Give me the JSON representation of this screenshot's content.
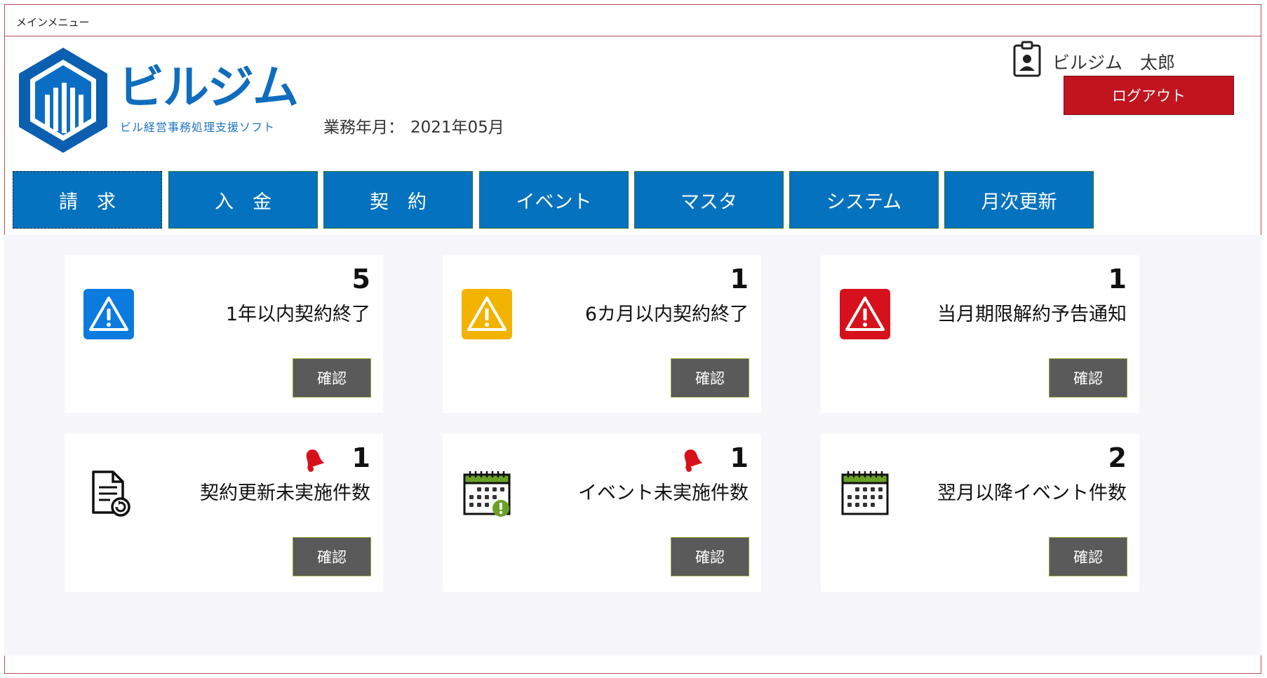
{
  "window": {
    "title": "メインメニュー"
  },
  "brand": {
    "name": "ビルジム",
    "subtitle": "ビル経営事務処理支援ソフト"
  },
  "work_period": {
    "label": "業務年月：",
    "value": "2021年05月"
  },
  "user": {
    "name": "ビルジム　太郎",
    "logout_label": "ログアウト"
  },
  "nav": {
    "tabs": [
      {
        "label": "請　求"
      },
      {
        "label": "入　金"
      },
      {
        "label": "契　約"
      },
      {
        "label": "イベント"
      },
      {
        "label": "マスタ"
      },
      {
        "label": "システム"
      },
      {
        "label": "月次更新"
      }
    ]
  },
  "cards": [
    {
      "count": "5",
      "label": "1年以内契約終了",
      "button": "確認",
      "icon": "warning-blue-icon",
      "color": "#0b7be0"
    },
    {
      "count": "1",
      "label": "6カ月以内契約終了",
      "button": "確認",
      "icon": "warning-yellow-icon",
      "color": "#f2b300"
    },
    {
      "count": "1",
      "label": "当月期限解約予告通知",
      "button": "確認",
      "icon": "warning-red-icon",
      "color": "#d7111b"
    },
    {
      "count": "1",
      "label": "契約更新未実施件数",
      "button": "確認",
      "icon": "document-renew-icon",
      "bell": true
    },
    {
      "count": "1",
      "label": "イベント未実施件数",
      "button": "確認",
      "icon": "calendar-alert-icon",
      "bell": true
    },
    {
      "count": "2",
      "label": "翌月以降イベント件数",
      "button": "確認",
      "icon": "calendar-icon"
    }
  ],
  "colors": {
    "nav_blue": "#0572bf",
    "logout_red": "#c0141f",
    "button_gray": "#5a5a5a",
    "bell_red": "#d7111b",
    "calendar_green": "#6aa127"
  }
}
